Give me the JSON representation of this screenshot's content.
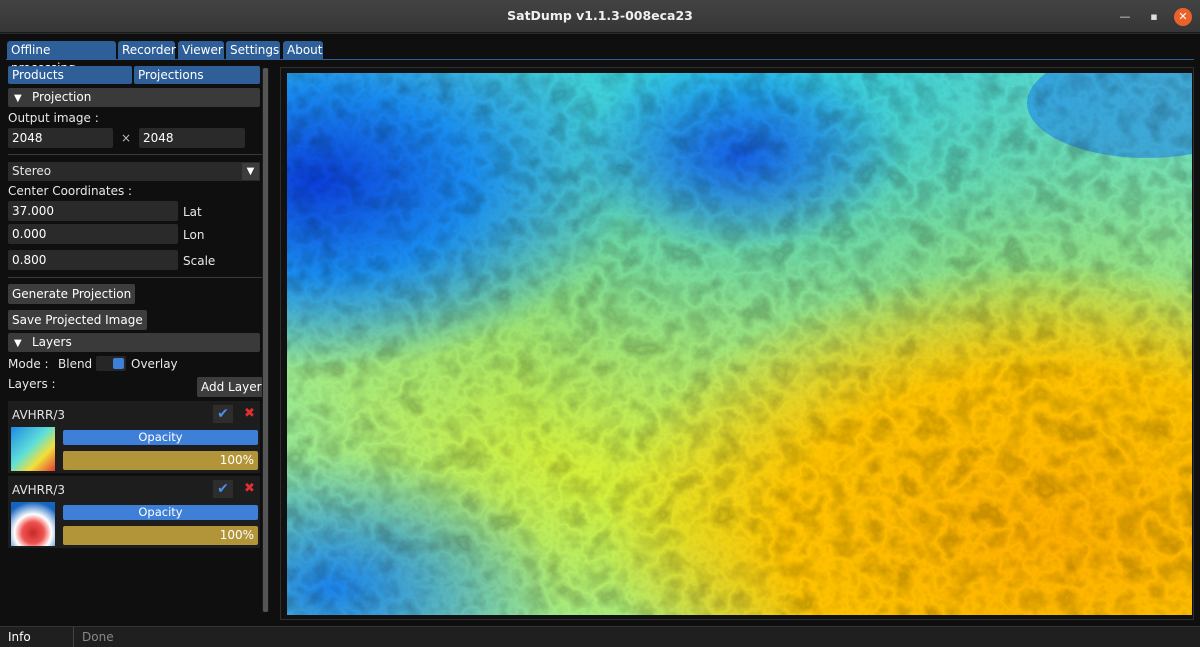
{
  "window": {
    "title": "SatDump v1.1.3-008eca23"
  },
  "tabs": [
    "Offline processing",
    "Recorder",
    "Viewer",
    "Settings",
    "About"
  ],
  "subtabs": [
    "Products",
    "Projections"
  ],
  "projection": {
    "header": "Projection",
    "output_label": "Output image :",
    "width": "2048",
    "times": "×",
    "height": "2048",
    "type": "Stereo",
    "center_label": "Center Coordinates :",
    "lat": "37.000",
    "lat_label": "Lat",
    "lon": "0.000",
    "lon_label": "Lon",
    "scale": "0.800",
    "scale_label": "Scale",
    "generate": "Generate Projection",
    "save": "Save Projected Image"
  },
  "layers": {
    "header": "Layers",
    "mode_label": "Mode :",
    "blend": "Blend",
    "overlay": "Overlay",
    "layers_label": "Layers :",
    "add": "Add Layer",
    "items": [
      {
        "name": "AVHRR/3",
        "opacity_label": "Opacity",
        "opacity": "100%"
      },
      {
        "name": "AVHRR/3",
        "opacity_label": "Opacity",
        "opacity": "100%"
      }
    ]
  },
  "status": {
    "tab": "Info",
    "text": "Done"
  },
  "colors": {
    "accent": "#2f5f99",
    "slider": "#3e7fd8",
    "opacity_bar": "#b39539",
    "close": "#e9622b"
  }
}
